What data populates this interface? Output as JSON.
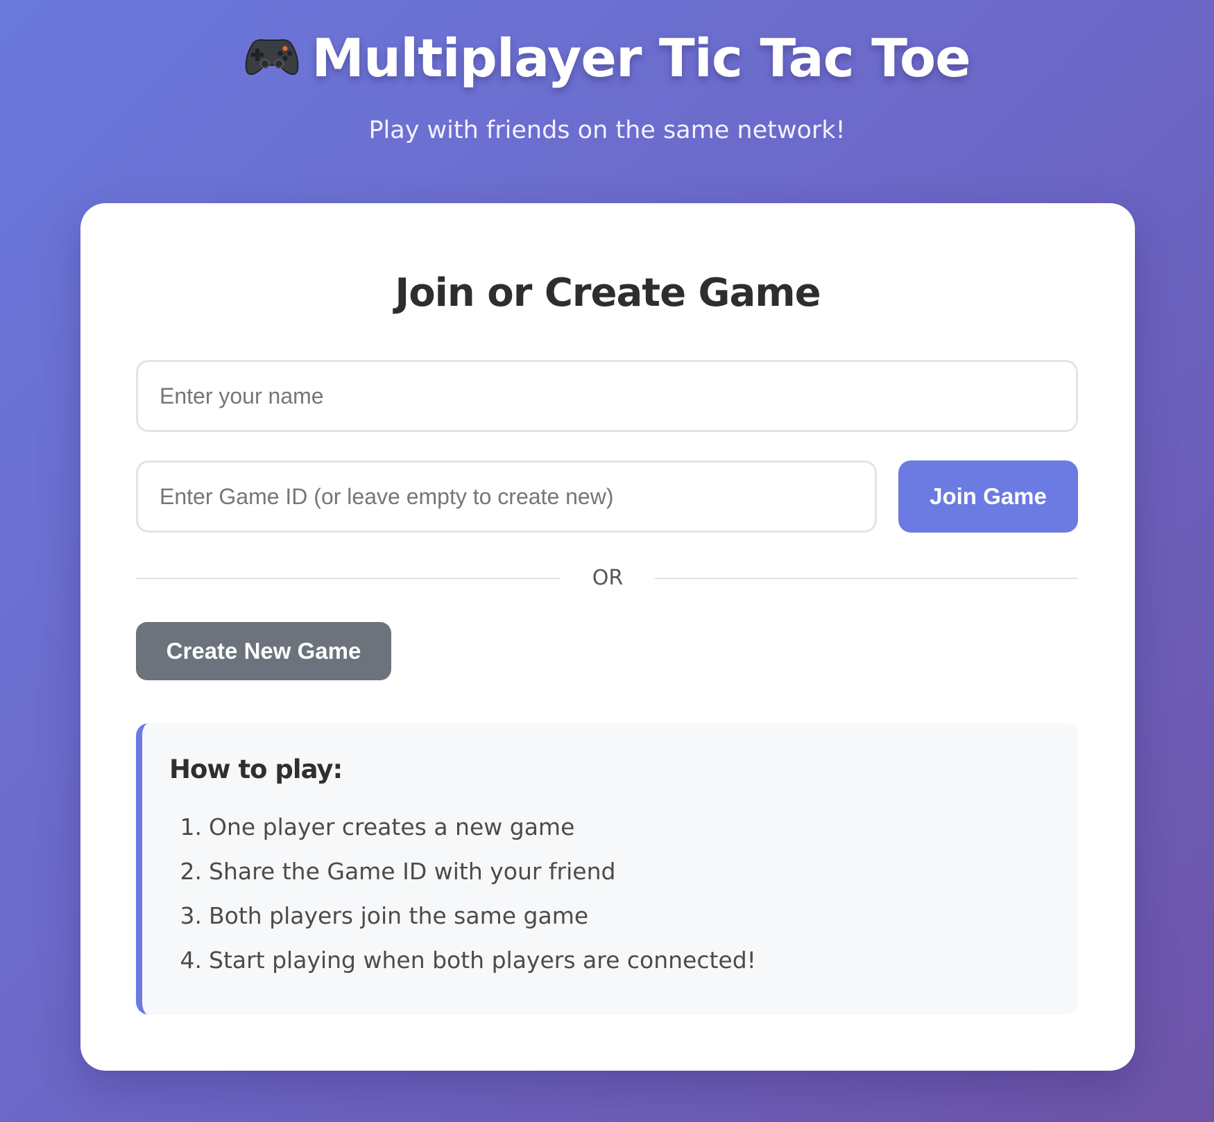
{
  "header": {
    "icon": "game-controller-icon",
    "title": "Multiplayer Tic Tac Toe",
    "subtitle": "Play with friends on the same network!"
  },
  "card": {
    "title": "Join or Create Game",
    "name_input": {
      "placeholder": "Enter your name",
      "value": ""
    },
    "game_id_input": {
      "placeholder": "Enter Game ID (or leave empty to create new)",
      "value": ""
    },
    "join_label": "Join Game",
    "divider_label": "OR",
    "create_label": "Create New Game"
  },
  "instructions": {
    "title": "How to play:",
    "steps": [
      {
        "number": "1.",
        "text": "One player creates a new game"
      },
      {
        "number": "2.",
        "text": "Share the Game ID with your friend"
      },
      {
        "number": "3.",
        "text": "Both players join the same game"
      },
      {
        "number": "4.",
        "text": "Start playing when both players are connected!"
      }
    ]
  },
  "colors": {
    "background_start": "#6b79dc",
    "background_end": "#6d54a8",
    "primary": "#6b7be2",
    "secondary": "#6c737c",
    "card": "#ffffff",
    "instructions_bg": "#f7f8fa"
  }
}
